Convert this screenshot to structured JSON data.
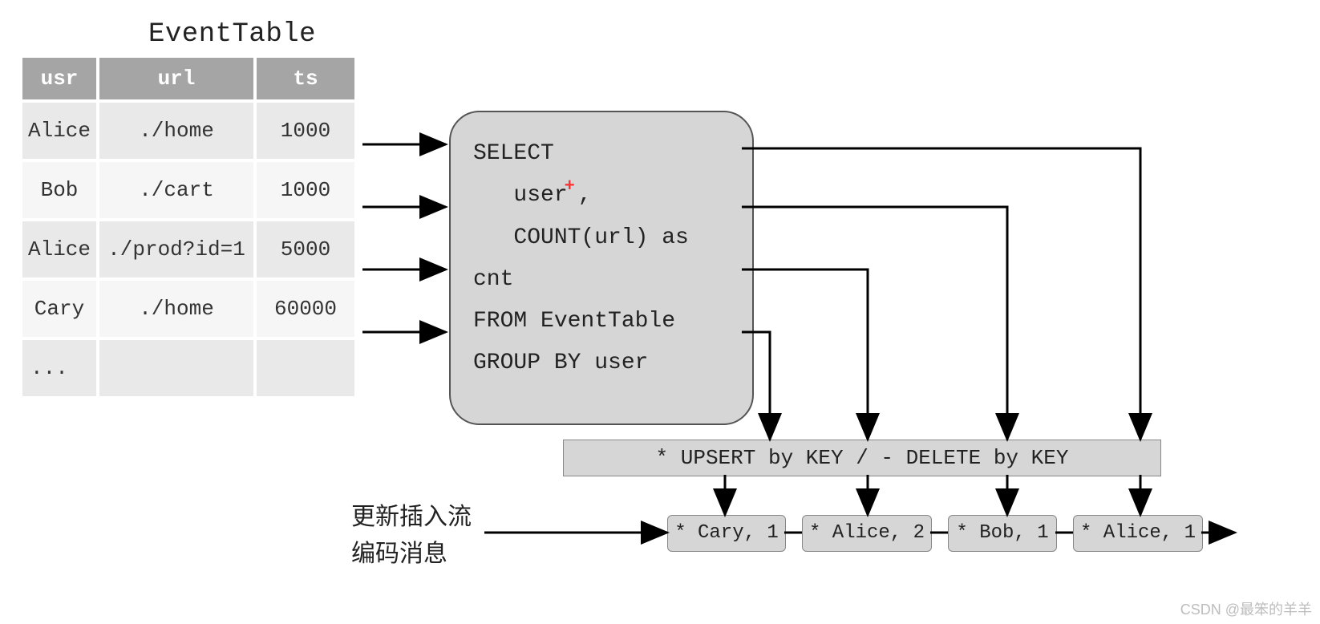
{
  "table": {
    "title": "EventTable",
    "headers": [
      "usr",
      "url",
      "ts"
    ],
    "rows": [
      {
        "usr": "Alice",
        "url": "./home",
        "ts": "1000"
      },
      {
        "usr": "Bob",
        "url": "./cart",
        "ts": "1000"
      },
      {
        "usr": "Alice",
        "url": "./prod?id=1",
        "ts": "5000"
      },
      {
        "usr": "Cary",
        "url": "./home",
        "ts": "60000"
      }
    ],
    "ellipsis": "..."
  },
  "sql": {
    "line1": "SELECT",
    "line2": "   user",
    "line3": "   COUNT(url) as",
    "line4": "cnt",
    "line5": "FROM EventTable",
    "line6": "GROUP BY user",
    "cursor": "+",
    "after_user": ","
  },
  "banner": "* UPSERT by KEY / - DELETE by KEY",
  "stream_label": {
    "line1": "更新插入流",
    "line2": "编码消息"
  },
  "outputs": [
    "* Cary, 1",
    "* Alice, 2",
    "* Bob, 1",
    "* Alice, 1"
  ],
  "watermark": "CSDN @最笨的羊羊"
}
